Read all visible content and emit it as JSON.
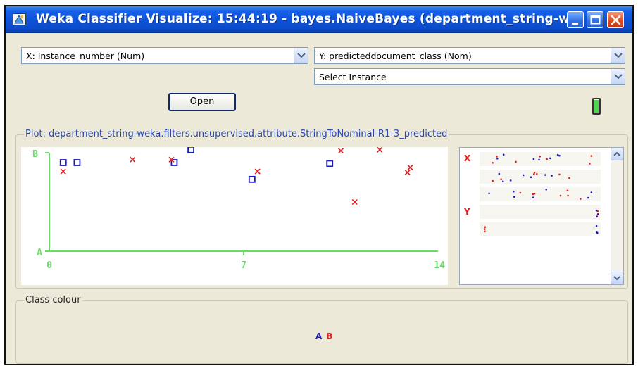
{
  "window": {
    "title": "Weka Classifier Visualize: 15:44:19 - bayes.NaiveBayes (department_string-w...",
    "controls": [
      "minimize-icon",
      "maximize-icon",
      "close-icon"
    ]
  },
  "controls": {
    "x_axis": "X: Instance_number (Num)",
    "y_axis": "Y: predicteddocument_class (Nom)",
    "instance_selector": "Select Instance",
    "open_label": "Open"
  },
  "plot": {
    "legend": "Plot: department_string-weka.filters.unsupervised.attribute.StringToNominal-R1-3_predicted"
  },
  "chart_data": {
    "type": "scatter",
    "title": "",
    "xlabel": "",
    "ylabel": "",
    "x_ticks": [
      "0",
      "7",
      "14"
    ],
    "y_ticks": [
      "A",
      "B"
    ],
    "xlim": [
      0,
      14
    ],
    "grid": false,
    "axis_color": "#66dd66",
    "series": [
      {
        "name": "A",
        "marker": "square",
        "color": "#1a1ac8",
        "points": [
          {
            "x": 0.5,
            "y": 0.9
          },
          {
            "x": 1.0,
            "y": 0.9
          },
          {
            "x": 4.5,
            "y": 0.9
          },
          {
            "x": 5.1,
            "y": 1.03
          },
          {
            "x": 7.3,
            "y": 0.73
          },
          {
            "x": 10.1,
            "y": 0.89
          }
        ]
      },
      {
        "name": "B",
        "marker": "cross",
        "color": "#e02020",
        "points": [
          {
            "x": 0.5,
            "y": 0.81
          },
          {
            "x": 3.0,
            "y": 0.93
          },
          {
            "x": 4.4,
            "y": 0.93
          },
          {
            "x": 7.5,
            "y": 0.81
          },
          {
            "x": 10.5,
            "y": 1.02
          },
          {
            "x": 11.0,
            "y": 0.5
          },
          {
            "x": 11.9,
            "y": 1.03
          },
          {
            "x": 13.0,
            "y": 0.85
          },
          {
            "x": 12.9,
            "y": 0.8
          }
        ]
      }
    ]
  },
  "attribute_panel": {
    "x_label": "X",
    "y_label": "Y"
  },
  "class_colour": {
    "legend": "Class colour",
    "classes": [
      {
        "label": "A",
        "color": "#1a1ac8"
      },
      {
        "label": "B",
        "color": "#e02020"
      }
    ]
  }
}
